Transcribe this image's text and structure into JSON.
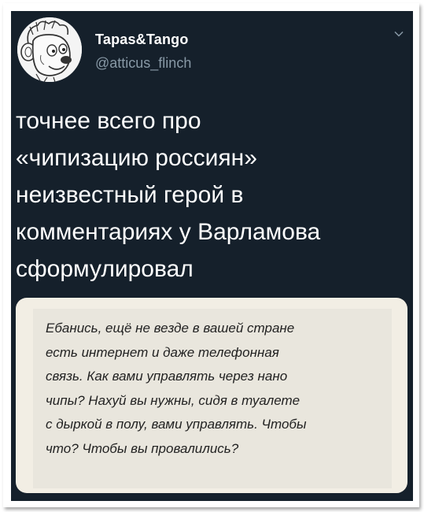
{
  "tweet": {
    "display_name": "Tapas&Tango",
    "handle": "@atticus_flinch",
    "text": "точнее всего про\n«чипизацию россиян»\nнеизвестный герой в\nкомментариях у Варламова\nсформулировал",
    "avatar_icon": "cartoon-bear-avatar",
    "menu_icon": "chevron-down-icon"
  },
  "media": {
    "quote_text": "Ебанись, ещё не везде в вашей стране\nесть интернет и даже телефонная\nсвязь. Как вами управлять через нано\nчипы? Нахуй вы нужны, сидя в туалете\nс дыркой в полу, вами управлять. Чтобы\nчто? Чтобы вы провалились?"
  },
  "colors": {
    "tweet_background": "#15202b",
    "primary_text": "#ffffff",
    "secondary_text": "#8899a6",
    "media_background": "#f2eee4"
  }
}
